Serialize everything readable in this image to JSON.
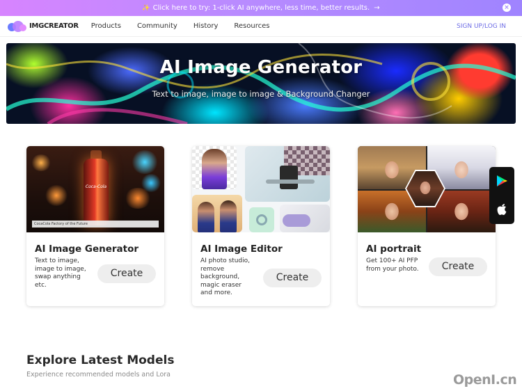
{
  "promo": {
    "spark": "✨",
    "text": "Click here to try: 1-click AI anywhere, less time, better results.",
    "arrow": "→",
    "close": "×"
  },
  "nav": {
    "logo": "IMGCREATOR",
    "links": [
      "Products",
      "Community",
      "History",
      "Resources"
    ],
    "signup": "SIGN UP/LOG IN"
  },
  "hero": {
    "title": "AI Image Generator",
    "subtitle": "Text to image, image to image & Background Changer"
  },
  "cards": [
    {
      "title": "AI Image Generator",
      "description": [
        "Text to image,",
        "image to image,",
        "swap anything",
        "etc."
      ],
      "button": "Create",
      "image_caption": "CocaCola Factory of the Future",
      "image_label": "Coca-Cola"
    },
    {
      "title": "AI Image Editor",
      "description": [
        "AI photo studio,",
        "remove",
        "background,",
        "magic eraser",
        "and more."
      ],
      "button": "Create"
    },
    {
      "title": "AI portrait",
      "description": [
        "Get 100+ AI PFP",
        "from your photo."
      ],
      "button": "Create"
    }
  ],
  "app_buttons": {
    "google_play": "google-play-icon",
    "apple": "apple-icon"
  },
  "explore": {
    "title": "Explore Latest Models",
    "subtitle": "Experience recommended models and Lora"
  },
  "watermark": "OpenI.cn",
  "colors": {
    "accent": "#6f6ee6",
    "promo_start": "#d784ff",
    "promo_end": "#9f84ff",
    "button_bg": "#eeeeee"
  }
}
